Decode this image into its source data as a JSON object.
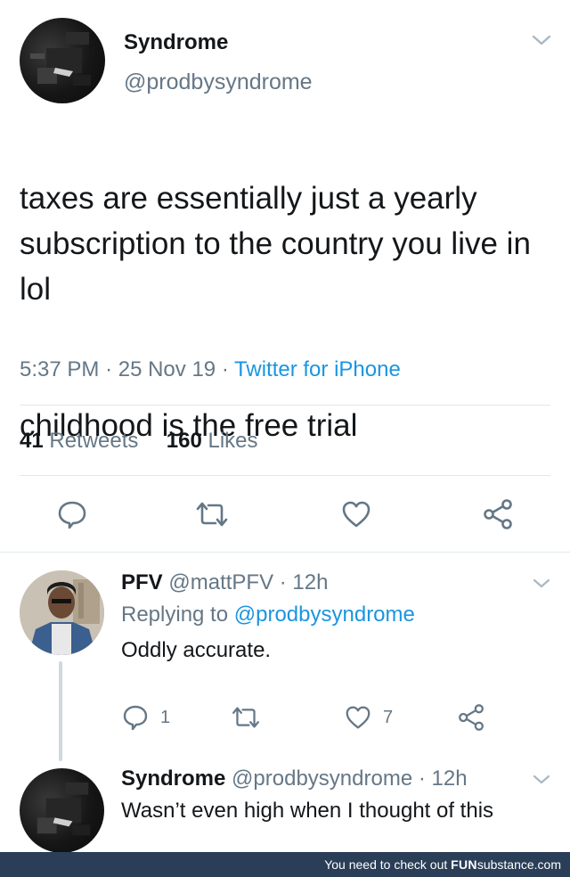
{
  "main_tweet": {
    "author_name": "Syndrome",
    "author_handle": "@prodbysyndrome",
    "text_line1": "taxes are essentially just a yearly subscription to the country you live in lol",
    "text_line2": "childhood is the free trial",
    "time": "5:37 PM",
    "date": "25 Nov 19",
    "source": "Twitter for iPhone",
    "retweets_count": "41",
    "retweets_label": "Retweets",
    "likes_count": "160",
    "likes_label": "Likes"
  },
  "replies": [
    {
      "author_name": "PFV",
      "author_handle": "@mattPFV",
      "age": "12h",
      "replying_label": "Replying to",
      "replying_handle": "@prodbysyndrome",
      "text": "Oddly accurate.",
      "reply_count": "1",
      "like_count": "7"
    },
    {
      "author_name": "Syndrome",
      "author_handle": "@prodbysyndrome",
      "age": "12h",
      "text": "Wasn’t even high when I thought of this"
    }
  ],
  "footer": {
    "lead": "You need to check out",
    "brand_a": "FUN",
    "brand_b": "substance",
    "brand_c": ".com"
  },
  "icons": [
    "chevron-down-icon",
    "reply-icon",
    "retweet-icon",
    "like-icon",
    "share-icon"
  ],
  "colors": {
    "link": "#1b95e0",
    "muted": "#657786",
    "text": "#14171a",
    "footer_bg": "#2a3e58"
  }
}
